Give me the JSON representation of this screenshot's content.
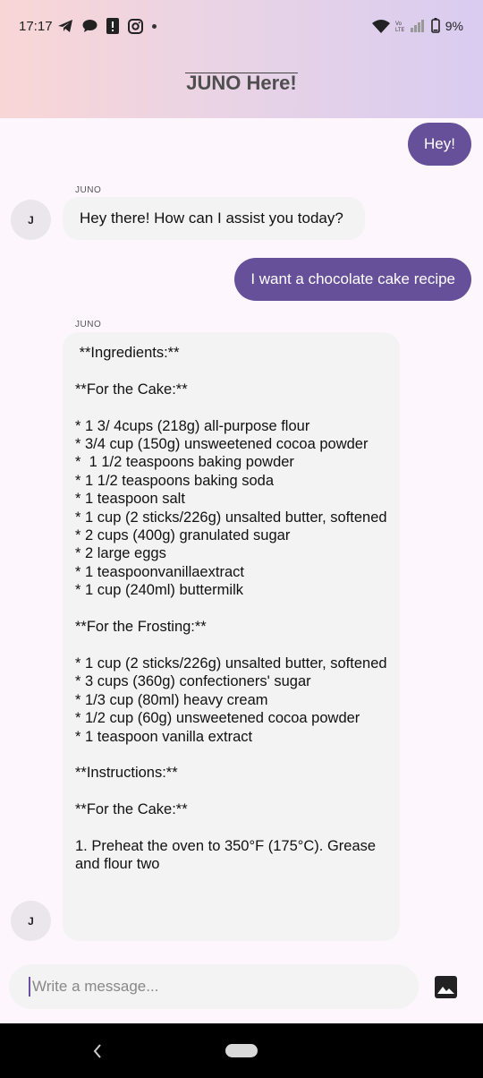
{
  "status_bar": {
    "time": "17:17",
    "battery": "9%"
  },
  "header": {
    "title": "JUNO Here!"
  },
  "messages": {
    "user1": "Hey!",
    "bot1_sender": "JUNO",
    "bot1_avatar": "J",
    "bot1": "Hey there! How can I assist you today?",
    "user2": "I want a chocolate cake recipe",
    "bot2_sender": "JUNO",
    "bot2_avatar": "J",
    "bot2": " **Ingredients:**\n\n**For the Cake:**\n\n* 1 3/ 4cups (218g) all-purpose flour\n* 3/4 cup (150g) unsweetened cocoa powder\n*  1 1/2 teaspoons baking powder\n* 1 1/2 teaspoons baking soda\n* 1 teaspoon salt\n* 1 cup (2 sticks/226g) unsalted butter, softened\n* 2 cups (400g) granulated sugar\n* 2 large eggs\n* 1 teaspoonvanillaextract\n* 1 cup (240ml) buttermilk\n\n**For the Frosting:**\n\n* 1 cup (2 sticks/226g) unsalted butter, softened\n* 3 cups (360g) confectioners' sugar\n* 1/3 cup (80ml) heavy cream\n* 1/2 cup (60g) unsweetened cocoa powder\n* 1 teaspoon vanilla extract\n\n**Instructions:**\n\n**For the Cake:**\n\n1. Preheat the oven to 350°F (175°C). Grease and flour two"
  },
  "composer": {
    "placeholder": "Write a message..."
  },
  "icons": {
    "telegram": "telegram-icon",
    "chat": "chat-icon",
    "alert": "alert-icon",
    "instagram": "instagram-icon",
    "wifi": "wifi-icon",
    "signal": "signal-icon",
    "battery": "battery-icon",
    "image": "image-icon",
    "back": "back-icon"
  }
}
